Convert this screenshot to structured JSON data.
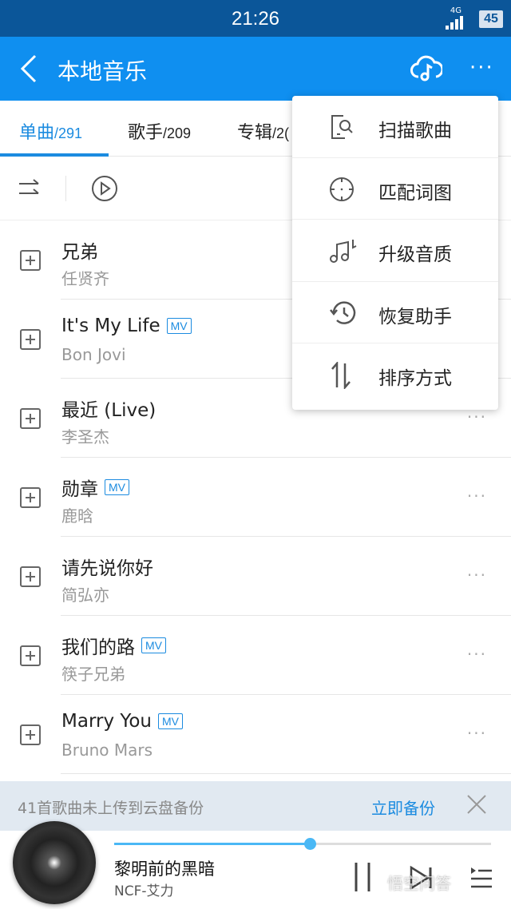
{
  "status": {
    "time": "21:26",
    "network": "4G",
    "battery": "45"
  },
  "header": {
    "title": "本地音乐",
    "back_icon": "chevron-left-icon",
    "cloud_icon": "cloud-music-icon",
    "more_icon": "more-icon"
  },
  "tabs": [
    {
      "label": "单曲",
      "count": "/291"
    },
    {
      "label": "歌手",
      "count": "/209"
    },
    {
      "label": "专辑",
      "count": "/2("
    }
  ],
  "songs": [
    {
      "title": "兄弟",
      "artist": "任贤齐",
      "mv": false
    },
    {
      "title": "It's My Life",
      "artist": "Bon Jovi",
      "mv": true
    },
    {
      "title": "最近 (Live)",
      "artist": "李圣杰",
      "mv": false
    },
    {
      "title": "勋章",
      "artist": "鹿晗",
      "mv": true
    },
    {
      "title": "请先说你好",
      "artist": "简弘亦",
      "mv": false
    },
    {
      "title": "我们的路",
      "artist": "筷子兄弟",
      "mv": true
    },
    {
      "title": "Marry You",
      "artist": "Bruno Mars",
      "mv": true
    }
  ],
  "mv_label": "MV",
  "menu": [
    {
      "label": "扫描歌曲",
      "icon": "scan-phone-icon"
    },
    {
      "label": "匹配词图",
      "icon": "crosshair-icon"
    },
    {
      "label": "升级音质",
      "icon": "music-note-icon"
    },
    {
      "label": "恢复助手",
      "icon": "history-icon"
    },
    {
      "label": "排序方式",
      "icon": "sort-icon"
    }
  ],
  "banner": {
    "message": "41首歌曲未上传到云盘备份",
    "action": "立即备份"
  },
  "player": {
    "title": "黎明前的黑暗",
    "artist": "NCF-艾力",
    "progress_percent": 52
  },
  "accent": "#0f8ff0",
  "watermark": "悟空问答"
}
